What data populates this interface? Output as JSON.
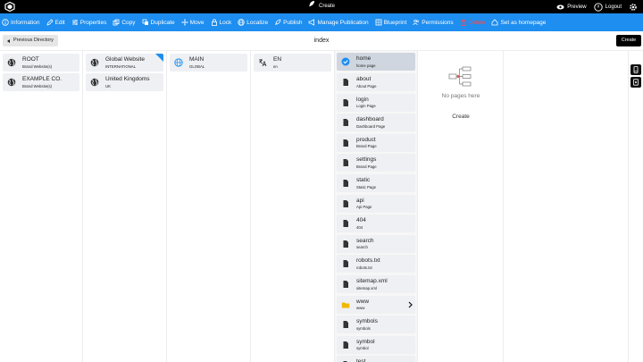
{
  "topbar": {
    "title": "Create",
    "preview": "Preview",
    "logout": "Logout"
  },
  "toolbar": {
    "items": [
      {
        "label": "Information",
        "icon": "info-icon"
      },
      {
        "label": "Edit",
        "icon": "pencil-icon"
      },
      {
        "label": "Properties",
        "icon": "sliders-icon"
      },
      {
        "label": "Copy",
        "icon": "copy-icon"
      },
      {
        "label": "Duplicate",
        "icon": "duplicate-icon"
      },
      {
        "label": "Move",
        "icon": "move-icon"
      },
      {
        "label": "Lock",
        "icon": "lock-icon"
      },
      {
        "label": "Localize",
        "icon": "globe-icon"
      },
      {
        "label": "Publish",
        "icon": "rocket-icon"
      },
      {
        "label": "Manage Publication",
        "icon": "megaphone-icon"
      },
      {
        "label": "Blueprint",
        "icon": "blueprint-icon"
      },
      {
        "label": "Permissions",
        "icon": "users-icon"
      },
      {
        "label": "Delete",
        "icon": "trash-icon"
      },
      {
        "label": "Set as homepage",
        "icon": "home-icon"
      }
    ],
    "delete_color": "#ff4a4a"
  },
  "subbar": {
    "previous": "Previous Directory",
    "title": "index",
    "create": "Create"
  },
  "columns": {
    "c1": [
      {
        "title": "ROOT",
        "sub": "Brand Website(s)"
      },
      {
        "title": "EXAMPLE CO.",
        "sub": "Brand Website(s)"
      }
    ],
    "c2": [
      {
        "title": "Global Website",
        "sub": "INTERNATIONAL"
      },
      {
        "title": "United Kingdoms",
        "sub": "UK"
      }
    ],
    "c3": [
      {
        "title": "MAIN",
        "sub": "GLOBAL"
      }
    ],
    "c4": [
      {
        "title": "EN",
        "sub": "en"
      }
    ],
    "c5": [
      {
        "title": "home",
        "sub": "home page",
        "icon": "check-circle-icon"
      },
      {
        "title": "about",
        "sub": "About Page",
        "icon": "page-icon"
      },
      {
        "title": "login",
        "sub": "Login Page",
        "icon": "page-icon"
      },
      {
        "title": "dashboard",
        "sub": "Dashboard Page",
        "icon": "page-icon"
      },
      {
        "title": "product",
        "sub": "Brand Page",
        "icon": "page-icon"
      },
      {
        "title": "settings",
        "sub": "Brand Page",
        "icon": "page-icon"
      },
      {
        "title": "static",
        "sub": "Static Page",
        "icon": "page-icon"
      },
      {
        "title": "api",
        "sub": "Api Page",
        "icon": "page-icon"
      },
      {
        "title": "404",
        "sub": "404",
        "icon": "page-icon"
      },
      {
        "title": "search",
        "sub": "search",
        "icon": "page-icon"
      },
      {
        "title": "robots.txt",
        "sub": "robots.txt",
        "icon": "page-icon"
      },
      {
        "title": "sitemap.xml",
        "sub": "sitemap.xml",
        "icon": "page-icon"
      },
      {
        "title": "www",
        "sub": "www",
        "icon": "folder-icon"
      },
      {
        "title": "symbols",
        "sub": "symbols",
        "icon": "page-icon"
      },
      {
        "title": "symbol",
        "sub": "symbol",
        "icon": "page-icon"
      },
      {
        "title": "test",
        "sub": "",
        "icon": "page-icon"
      }
    ],
    "c6": {
      "empty_message": "No pages here",
      "create": "Create"
    }
  },
  "colors": {
    "accent": "#1e8ef0",
    "card": "#eef0f3",
    "selected": "#cfd6df",
    "folder": "#f2b705"
  }
}
